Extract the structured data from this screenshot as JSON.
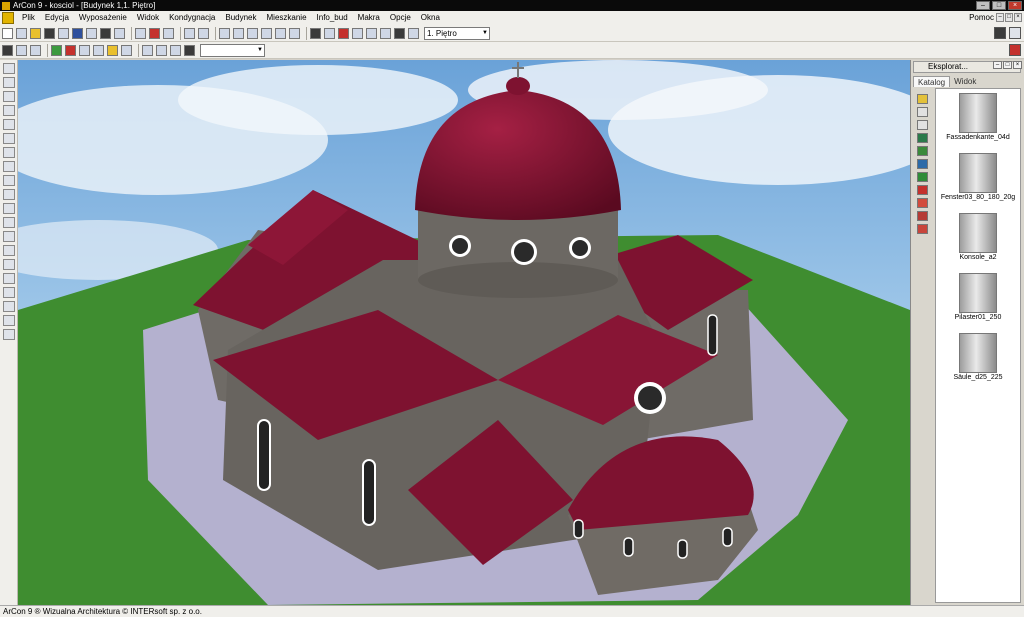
{
  "window": {
    "title": "ArCon 9 - kosciol - [Budynek 1,1. Piętro]"
  },
  "menu": {
    "items": [
      "Plik",
      "Edycja",
      "Wyposażenie",
      "Widok",
      "Kondygnacja",
      "Budynek",
      "Mieszkanie",
      "Info_bud",
      "Makra",
      "Opcje",
      "Okna"
    ],
    "help": "Pomoc"
  },
  "toolbar": {
    "floor_select": "1. Piętro",
    "second_select": ""
  },
  "explorer": {
    "title": "Eksplorat...",
    "tabs": [
      "Katalog",
      "Widok"
    ],
    "items": [
      {
        "label": "Fassadenkante_04d",
        "icon": "facade-edge-icon"
      },
      {
        "label": "Fenster03_80_180_20g",
        "icon": "window-icon"
      },
      {
        "label": "Konsole_a2",
        "icon": "console-icon"
      },
      {
        "label": "Pilaster01_250",
        "icon": "pilaster-icon"
      },
      {
        "label": "Säule_d25_225",
        "icon": "column-icon"
      }
    ]
  },
  "statusbar": {
    "text": "ArCon 9 ® Wizualna Architektura © INTERsoft sp. z o.o."
  },
  "colors": {
    "roof": "#7e1230",
    "wall": "#6f6b66",
    "grass": "#3f8d30",
    "paving": "#b4b1cf",
    "sky": "#7fb1df"
  }
}
